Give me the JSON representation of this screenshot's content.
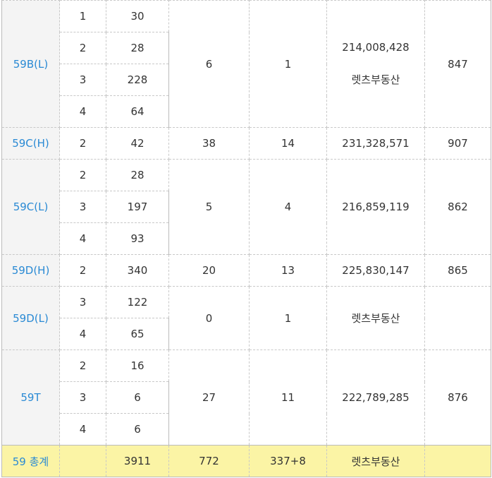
{
  "rows": {
    "r59BL": {
      "type": "59B(L)",
      "floors": [
        "1",
        "2",
        "3",
        "4"
      ],
      "units": [
        "30",
        "28",
        "228",
        "64"
      ],
      "supply": "6",
      "subscribers": "1",
      "price": "214,008,428",
      "price_note": "렛츠부동산",
      "area": "847"
    },
    "r59CH": {
      "type": "59C(H)",
      "floors": [
        "2"
      ],
      "units": [
        "42"
      ],
      "supply": "38",
      "subscribers": "14",
      "price": "231,328,571",
      "area": "907"
    },
    "r59CL": {
      "type": "59C(L)",
      "floors": [
        "2",
        "3",
        "4"
      ],
      "units": [
        "28",
        "197",
        "93"
      ],
      "supply": "5",
      "subscribers": "4",
      "price": "216,859,119",
      "area": "862"
    },
    "r59DH": {
      "type": "59D(H)",
      "floors": [
        "2"
      ],
      "units": [
        "340"
      ],
      "supply": "20",
      "subscribers": "13",
      "price": "225,830,147",
      "area": "865"
    },
    "r59DL": {
      "type": "59D(L)",
      "floors": [
        "3",
        "4"
      ],
      "units": [
        "122",
        "65"
      ],
      "supply": "0",
      "subscribers": "1",
      "price": "렛츠부동산",
      "area": ""
    },
    "r59T": {
      "type": "59T",
      "floors": [
        "2",
        "3",
        "4"
      ],
      "units": [
        "16",
        "6",
        "6"
      ],
      "supply": "27",
      "subscribers": "11",
      "price": "222,789,285",
      "area": "876"
    }
  },
  "total": {
    "type": "59 총계",
    "floor": "",
    "units": "3911",
    "supply": "772",
    "subscribers": "337+8",
    "price": "렛츠부동산",
    "area": ""
  }
}
